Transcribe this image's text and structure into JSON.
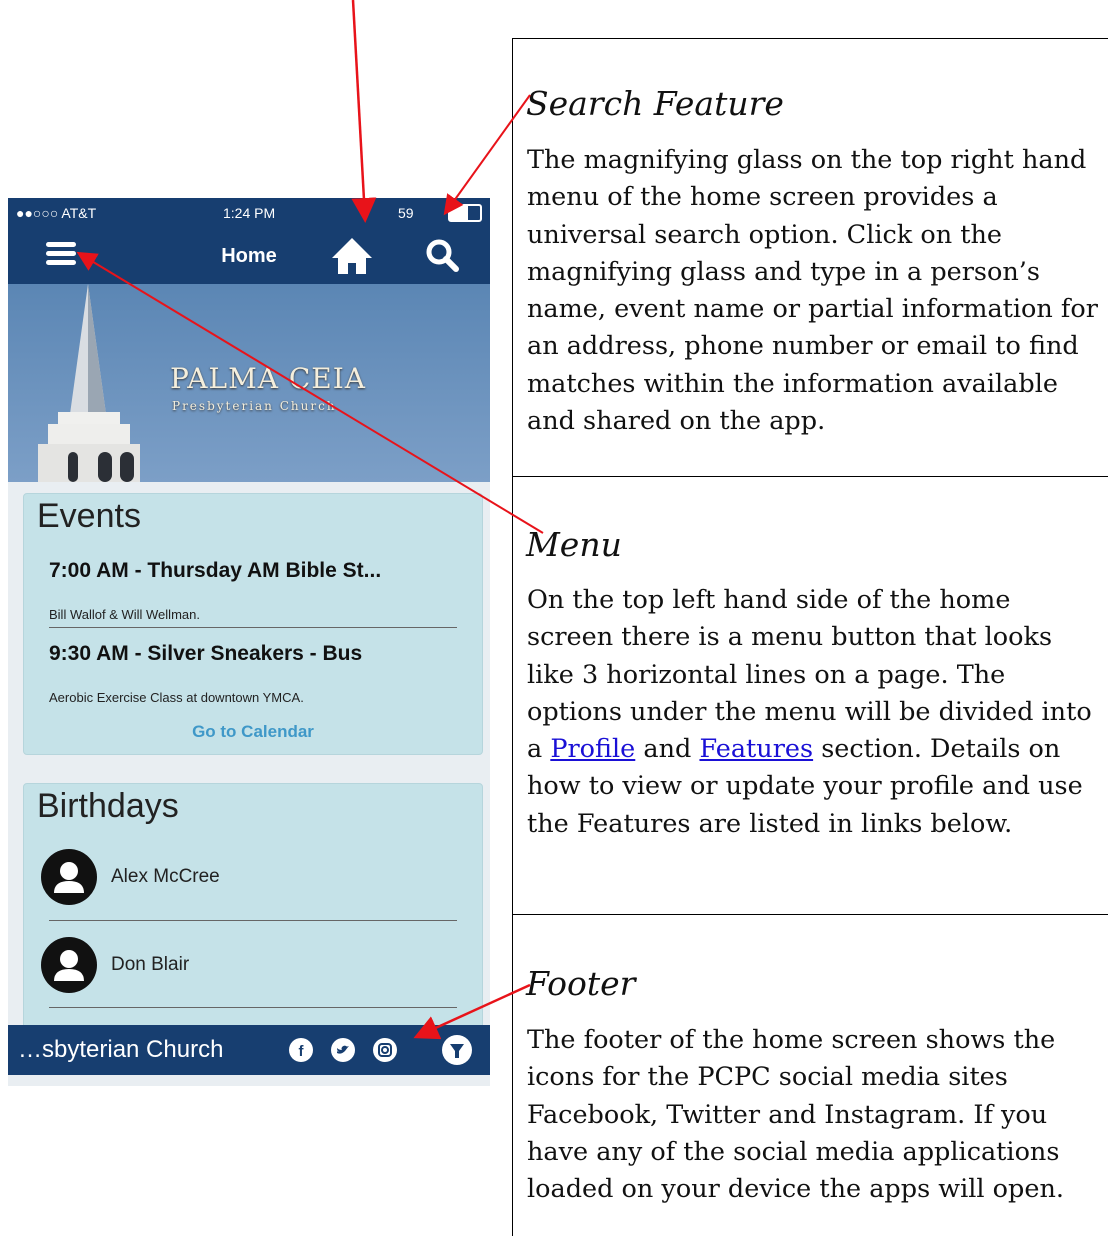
{
  "phone": {
    "status": {
      "carrier": "●●○○○ AT&T",
      "time": "1:24 PM",
      "battery": "59"
    },
    "nav": {
      "title": "Home"
    },
    "banner": {
      "logo_main": "PALMA CEIA",
      "logo_sub": "Presbyterian Church"
    },
    "events": {
      "heading": "Events",
      "items": [
        {
          "title": "7:00 AM - Thursday AM Bible St...",
          "desc": "Bill Wallof & Will Wellman."
        },
        {
          "title": "9:30 AM - Silver Sneakers - Bus",
          "desc": "Aerobic Exercise Class at downtown YMCA."
        }
      ],
      "calendar_link": "Go to Calendar"
    },
    "birthdays": {
      "heading": "Birthdays",
      "people": [
        "Alex McCree",
        "Don Blair"
      ]
    },
    "footer": {
      "church": "…sbyterian Church",
      "icons": [
        "facebook-icon",
        "twitter-icon",
        "instagram-icon",
        "filter-icon"
      ]
    },
    "colors": {
      "navy": "#173e70",
      "card": "#c5e2e8",
      "link": "#3f98c8"
    }
  },
  "sections": {
    "search": {
      "title": "Search Feature",
      "body": "The magnifying glass on the top right hand menu of the home screen provides a universal search option. Click on the magnifying glass and type in a person’s name, event name or partial information for an address, phone number or email to find matches within the information available and shared on the app."
    },
    "menu": {
      "title": "Menu",
      "body_before": "On the top left hand side of the home screen there is a menu button that looks like 3 horizontal lines on a page. The options under the menu will be divided into a ",
      "link_profile": "Profile",
      "body_and": " and ",
      "link_features": "Features",
      "body_after": " section. Details on how to view or update your profile and use the Features are listed in links below."
    },
    "footer": {
      "title": "Footer",
      "body": "The footer of the home screen shows the icons for the PCPC social media sites Facebook, Twitter and Instagram. If you have any of the social media applications loaded on your device the apps will open."
    }
  }
}
